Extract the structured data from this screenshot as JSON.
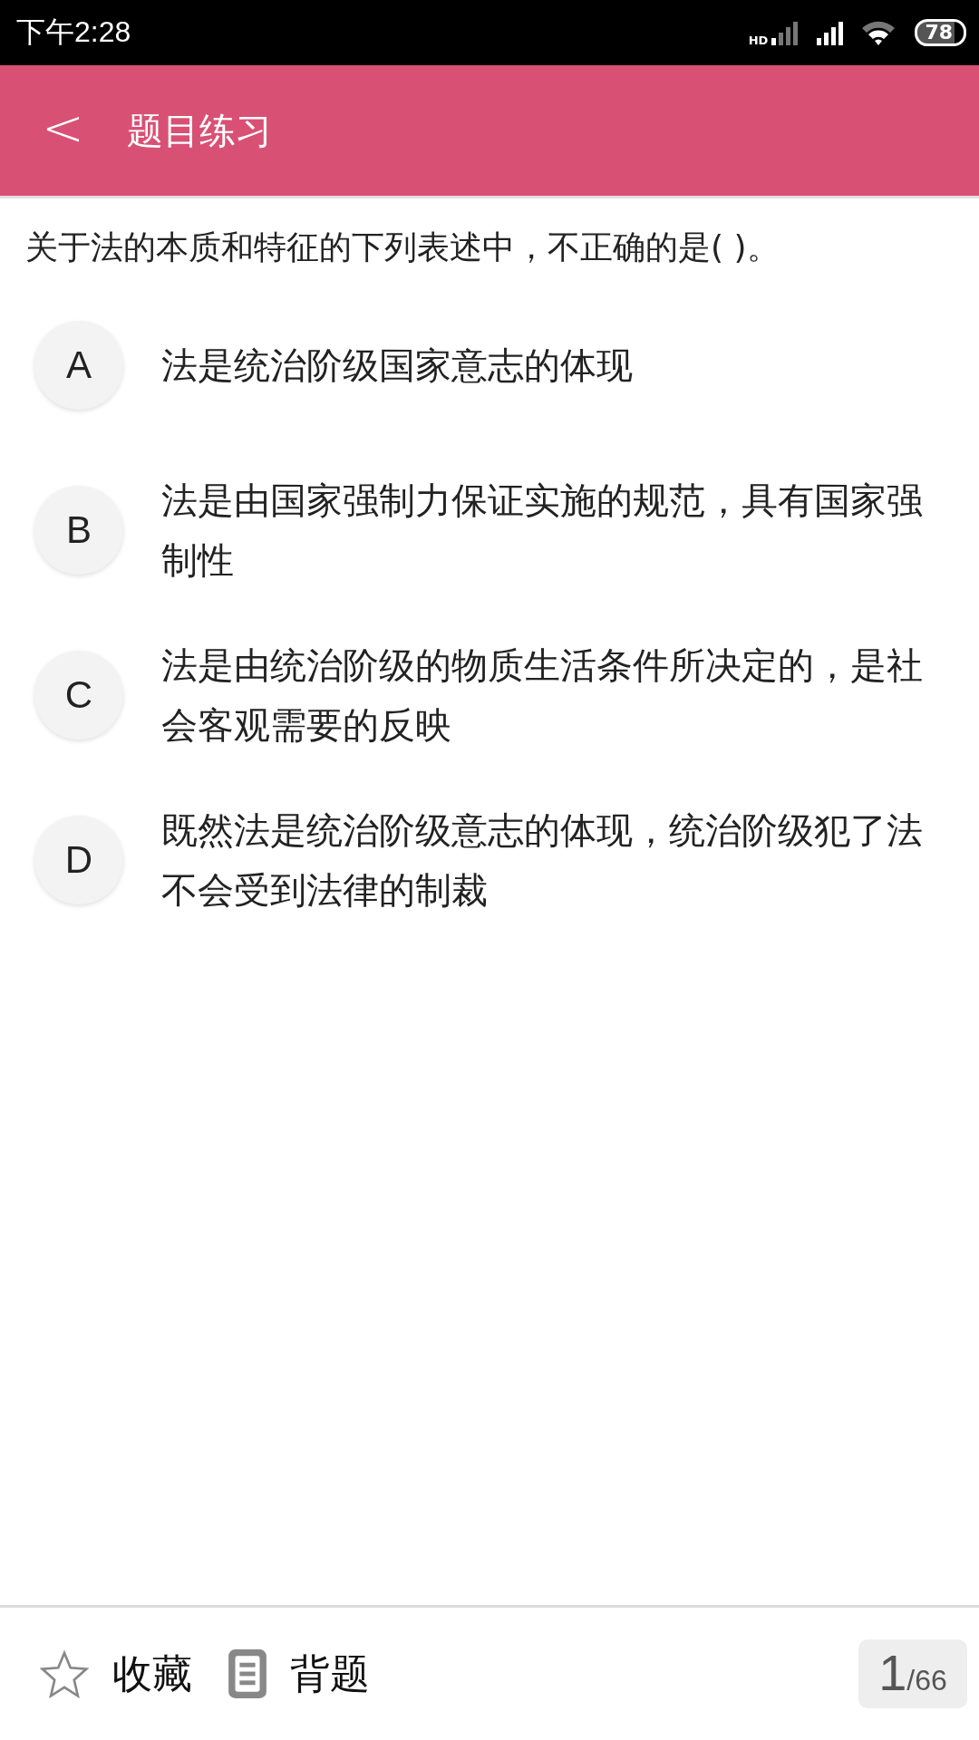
{
  "status_bar": {
    "time": "下午2:28",
    "network_label": "HD",
    "battery": "78"
  },
  "header": {
    "back": "<",
    "title": "题目练习"
  },
  "question": "关于法的本质和特征的下列表述中，不正确的是( )。",
  "options": [
    {
      "letter": "A",
      "text": "法是统治阶级国家意志的体现",
      "selected": false
    },
    {
      "letter": "B",
      "text": "法是由国家强制力保证实施的规范，具有国家强制性",
      "selected": false
    },
    {
      "letter": "C",
      "text": "法是由统治阶级的物质生活条件所决定的，是社会客观需要的反映",
      "selected": false
    },
    {
      "letter": "D",
      "text": "既然法是统治阶级意志的体现，统治阶级犯了法不会受到法律的制裁",
      "selected": false
    }
  ],
  "bottom_bar": {
    "favorite": "收藏",
    "favorited": false,
    "memorize": "背题",
    "current": "1",
    "total": "/66"
  }
}
